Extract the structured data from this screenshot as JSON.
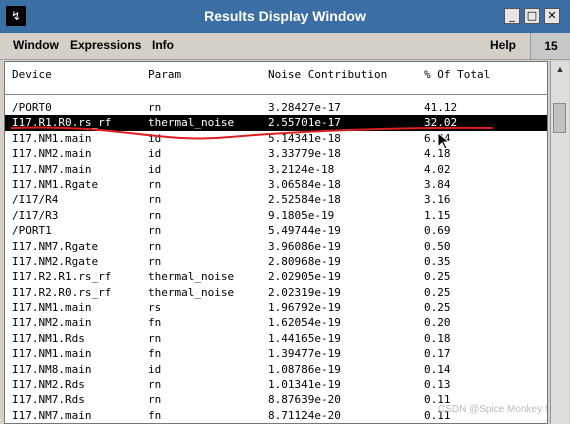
{
  "window": {
    "title": "Results Display Window",
    "icon_glyph": "↯",
    "controls": [
      "_",
      "□",
      "✕"
    ]
  },
  "menu": {
    "items": [
      "Window",
      "Expressions",
      "Info"
    ],
    "help": "Help",
    "counter": "15"
  },
  "table": {
    "headers": [
      "Device",
      "Param",
      "Noise Contribution",
      "% Of Total"
    ],
    "rows": [
      [
        "/PORT0",
        "rn",
        "3.28427e-17",
        "41.12"
      ],
      [
        "I17.R1.R0.rs_rf",
        "thermal_noise",
        "2.55701e-17",
        "32.02"
      ],
      [
        "I17.NM1.main",
        "id",
        "5.14341e-18",
        "6.44"
      ],
      [
        "I17.NM2.main",
        "id",
        "3.33779e-18",
        "4.18"
      ],
      [
        "I17.NM7.main",
        "id",
        "3.2124e-18",
        "4.02"
      ],
      [
        "I17.NM1.Rgate",
        "rn",
        "3.06584e-18",
        "3.84"
      ],
      [
        "/I17/R4",
        "rn",
        "2.52584e-18",
        "3.16"
      ],
      [
        "/I17/R3",
        "rn",
        "9.1805e-19",
        "1.15"
      ],
      [
        "/PORT1",
        "rn",
        "5.49744e-19",
        "0.69"
      ],
      [
        "I17.NM7.Rgate",
        "rn",
        "3.96086e-19",
        "0.50"
      ],
      [
        "I17.NM2.Rgate",
        "rn",
        "2.80968e-19",
        "0.35"
      ],
      [
        "I17.R2.R1.rs_rf",
        "thermal_noise",
        "2.02905e-19",
        "0.25"
      ],
      [
        "I17.R2.R0.rs_rf",
        "thermal_noise",
        "2.02319e-19",
        "0.25"
      ],
      [
        "I17.NM1.main",
        "rs",
        "1.96792e-19",
        "0.25"
      ],
      [
        "I17.NM2.main",
        "fn",
        "1.62054e-19",
        "0.20"
      ],
      [
        "I17.NM1.Rds",
        "rn",
        "1.44165e-19",
        "0.18"
      ],
      [
        "I17.NM1.main",
        "fn",
        "1.39477e-19",
        "0.17"
      ],
      [
        "I17.NM8.main",
        "id",
        "1.08786e-19",
        "0.14"
      ],
      [
        "I17.NM2.Rds",
        "rn",
        "1.01341e-19",
        "0.13"
      ],
      [
        "I17.NM7.Rds",
        "rn",
        "8.87639e-20",
        "0.11"
      ],
      [
        "I17.NM7.main",
        "fn",
        "8.71124e-20",
        "0.11"
      ]
    ],
    "selected_row": 1
  },
  "watermark": "CSDN @Spice Monkey !",
  "colors": {
    "titlebar": "#3a6ea5",
    "selection": "#000000",
    "annotation": "#e02020"
  }
}
